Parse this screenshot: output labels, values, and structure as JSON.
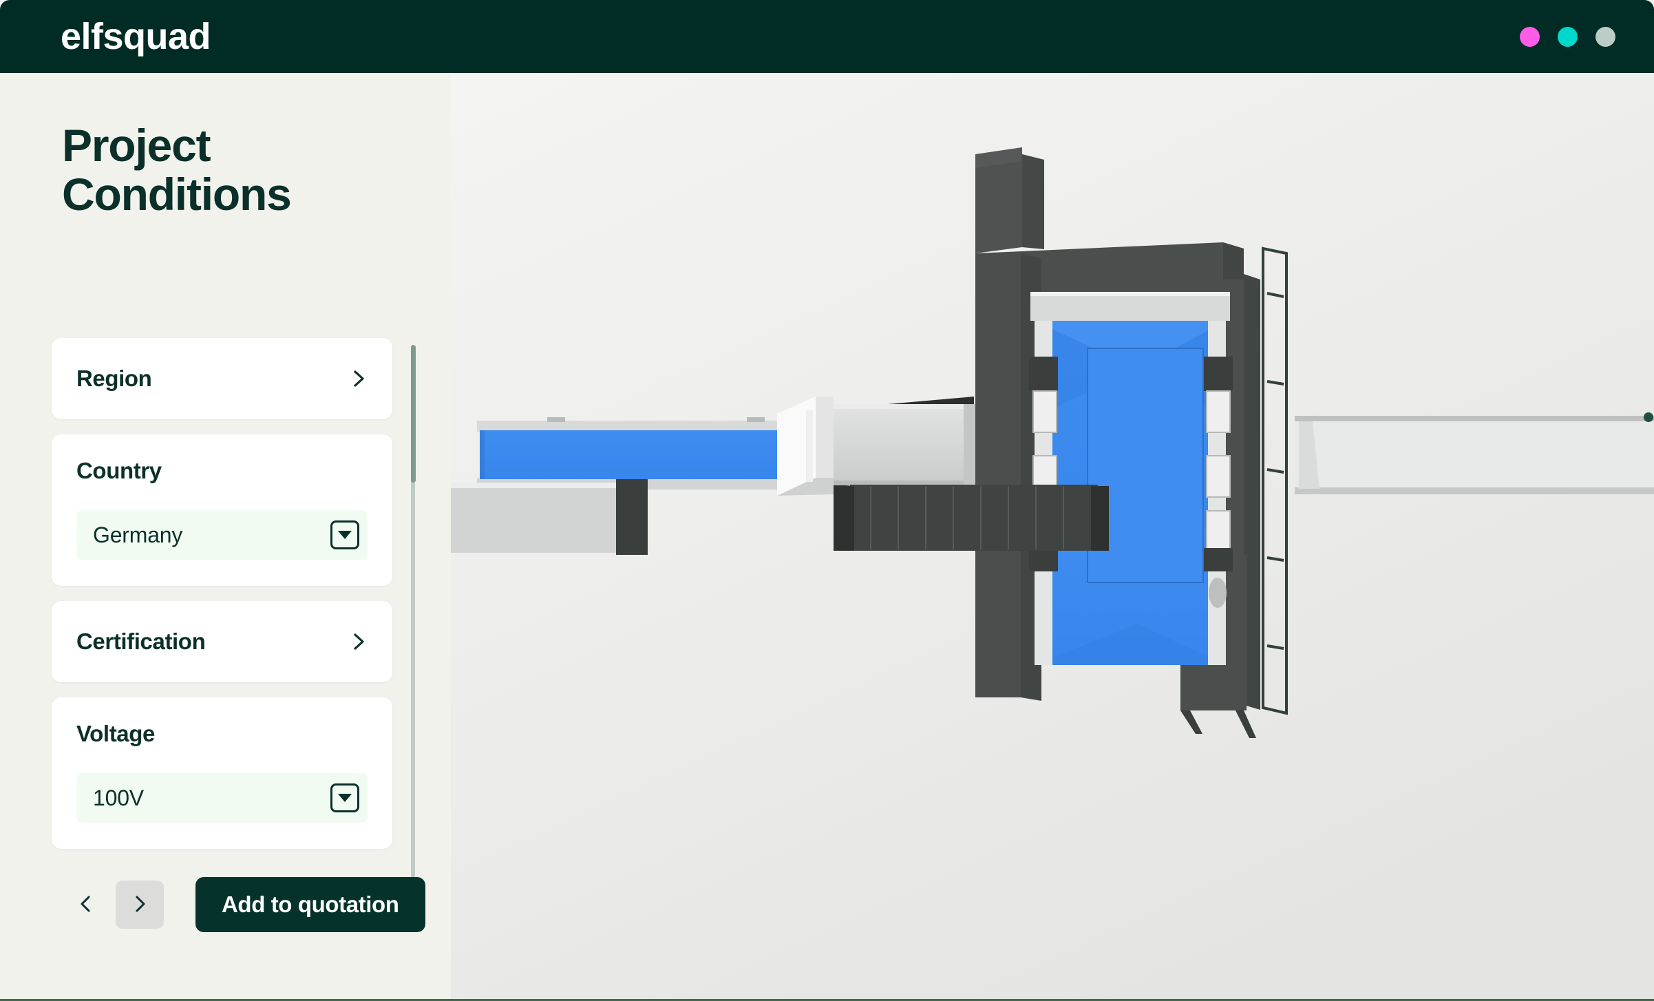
{
  "window": {
    "brand": "elfsquad",
    "controls": [
      {
        "name": "dot-pink",
        "color": "#FF5CE8"
      },
      {
        "name": "dot-cyan",
        "color": "#00D8CB"
      },
      {
        "name": "dot-grey",
        "color": "#BCCCC6"
      }
    ]
  },
  "sidebar": {
    "title": "Project\nConditions",
    "title_line1": "Project",
    "title_line2": "Conditions",
    "cards": [
      {
        "type": "link",
        "label": "Region",
        "icon": "chevron-right-icon"
      },
      {
        "type": "select",
        "label": "Country",
        "value": "Germany",
        "icon": "chevron-down-icon"
      },
      {
        "type": "link",
        "label": "Certification",
        "icon": "chevron-right-icon"
      },
      {
        "type": "select",
        "label": "Voltage",
        "value": "100V",
        "icon": "chevron-down-icon"
      }
    ],
    "footer": {
      "prev_icon": "chevron-left-icon",
      "next_icon": "chevron-right-icon",
      "next_active": true,
      "add_to_quotation_label": "Add to quotation"
    }
  },
  "viewer": {
    "model_name": "industrial-machine-3d-model",
    "accent_blue": "#3B8AEE",
    "frame_dark": "#4A4E4D",
    "panel_light": "#D4D6D5",
    "background": "#ECECEA"
  }
}
